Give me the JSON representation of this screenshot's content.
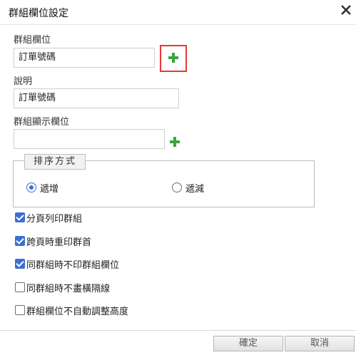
{
  "dialog": {
    "title": "群組欄位設定",
    "close_icon": "close-icon"
  },
  "group_field": {
    "label": "群組欄位",
    "value": "訂單號碼",
    "add_icon": "plus-icon"
  },
  "description": {
    "label": "說明",
    "value": "訂單號碼"
  },
  "display_field": {
    "label": "群組顯示欄位",
    "value": "",
    "add_icon": "plus-icon"
  },
  "sort": {
    "legend": "排序方式",
    "options": [
      {
        "label": "遞增",
        "checked": true
      },
      {
        "label": "遞減",
        "checked": false
      }
    ]
  },
  "options": [
    {
      "label": "分頁列印群組",
      "checked": true
    },
    {
      "label": "跨頁時重印群首",
      "checked": true
    },
    {
      "label": "同群組時不印群組欄位",
      "checked": true
    },
    {
      "label": "同群組時不畫橫隔線",
      "checked": false
    },
    {
      "label": "群組欄位不自動調整高度",
      "checked": false
    }
  ],
  "buttons": {
    "ok": "確定",
    "cancel": "取消"
  },
  "colors": {
    "accent": "#3b6fd4",
    "plus_green": "#3aa53a",
    "highlight": "#e53935"
  }
}
